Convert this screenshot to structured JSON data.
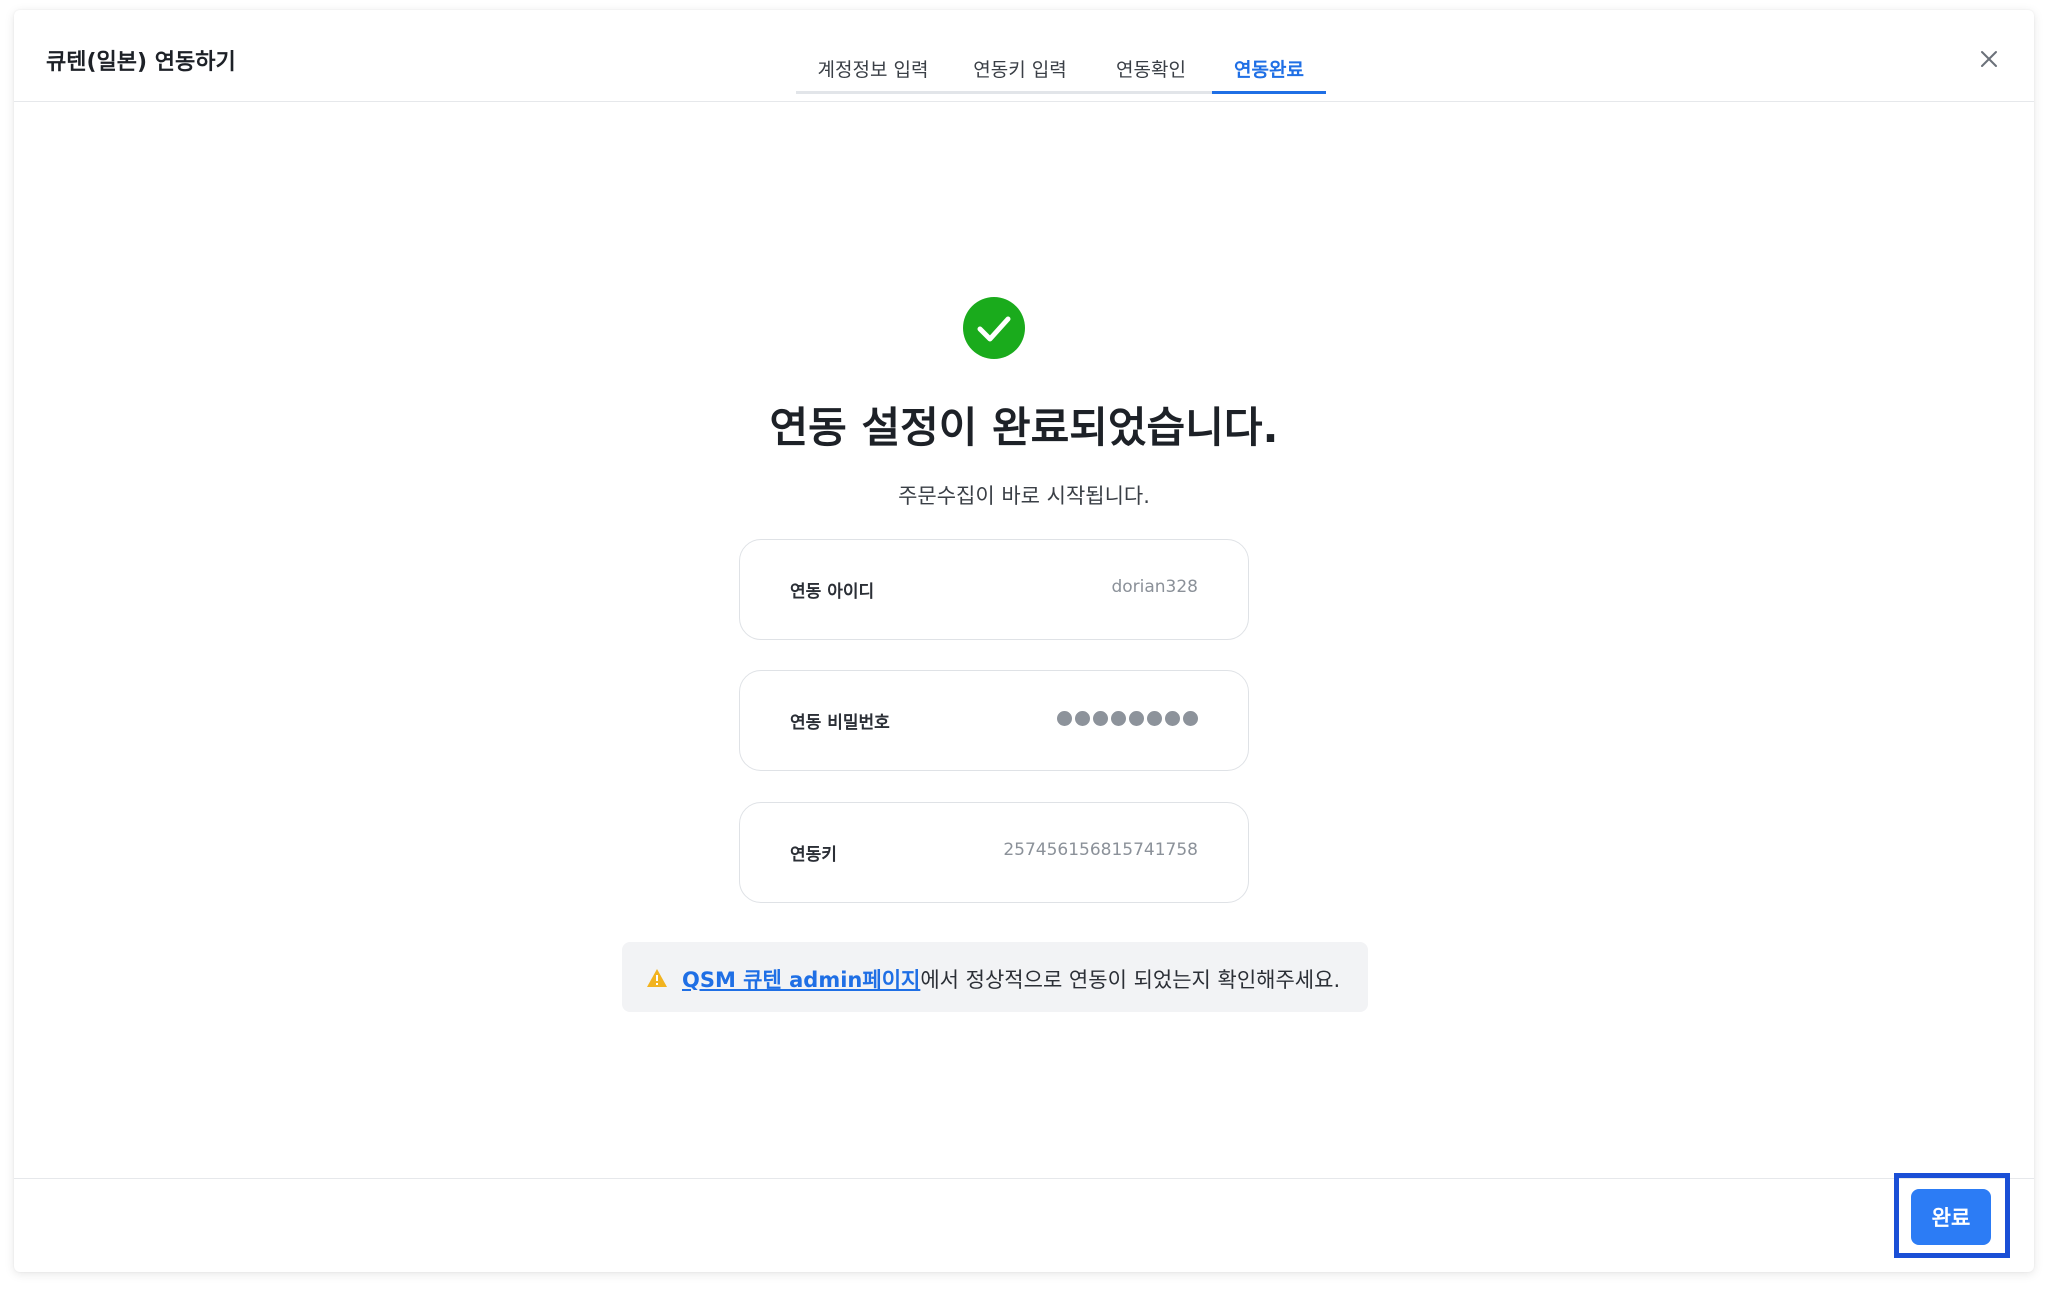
{
  "header": {
    "title": "큐텐(일본) 연동하기",
    "tabs": [
      {
        "label": "계정정보 입력",
        "active": false
      },
      {
        "label": "연동키 입력",
        "active": false
      },
      {
        "label": "연동확인",
        "active": false
      },
      {
        "label": "연동완료",
        "active": true
      }
    ],
    "close_icon": "close-icon"
  },
  "main": {
    "status_icon": "check-circle-icon",
    "title": "연동 설정이 완료되었습니다.",
    "subtitle": "주문수집이 바로 시작됩니다.",
    "info": [
      {
        "label": "연동 아이디",
        "value": "dorian328"
      },
      {
        "label": "연동 비밀번호",
        "value": "●●●●●●●●",
        "masked": true
      },
      {
        "label": "연동키",
        "value": "257456156815741758"
      }
    ],
    "notice": {
      "icon": "warning-icon",
      "link_text": "QSM 큐텐 admin페이지",
      "text": "에서 정상적으로 연동이 되었는지 확인해주세요."
    }
  },
  "footer": {
    "done_label": "완료"
  },
  "colors": {
    "accent": "#1f6fe5",
    "button": "#2c7cf5",
    "success": "#1aab1c",
    "warning": "#f2b31f",
    "highlight": "#1a4fd6"
  }
}
